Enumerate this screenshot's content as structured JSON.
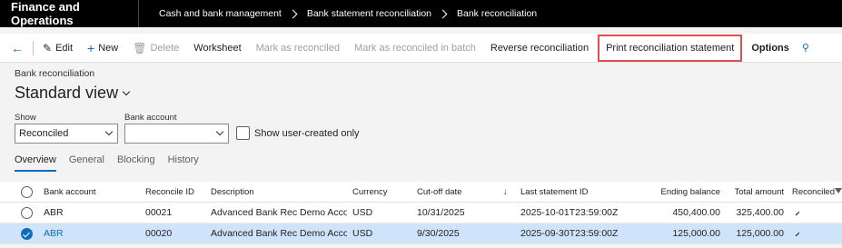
{
  "topbar": {
    "app_title": "Finance and Operations",
    "breadcrumbs": [
      "Cash and bank management",
      "Bank statement reconciliation",
      "Bank reconciliation"
    ]
  },
  "actions": {
    "edit": "Edit",
    "new": "New",
    "delete": "Delete",
    "worksheet": "Worksheet",
    "mark_reconciled": "Mark as reconciled",
    "mark_reconciled_batch": "Mark as reconciled in batch",
    "reverse": "Reverse reconciliation",
    "print_statement": "Print reconciliation statement",
    "options": "Options"
  },
  "page": {
    "breadcrumb": "Bank reconciliation",
    "title": "Standard view"
  },
  "filters": {
    "show_label": "Show",
    "show_value": "Reconciled",
    "bank_account_label": "Bank account",
    "bank_account_value": "",
    "user_created_label": "Show user-created only"
  },
  "tabs": [
    "Overview",
    "General",
    "Blocking",
    "History"
  ],
  "grid": {
    "headers": {
      "bank_account": "Bank account",
      "reconcile_id": "Reconcile ID",
      "description": "Description",
      "currency": "Currency",
      "cutoff": "Cut-off date",
      "last_statement": "Last statement ID",
      "ending_balance": "Ending balance",
      "total_amount": "Total amount",
      "reconciled": "Reconciled"
    },
    "rows": [
      {
        "bank_account": "ABR",
        "reconcile_id": "00021",
        "description": "Advanced Bank Rec Demo Acco…",
        "currency": "USD",
        "cutoff": "10/31/2025",
        "last_statement": "2025-10-01T23:59:00Z",
        "ending_balance": "450,400.00",
        "total_amount": "325,400.00"
      },
      {
        "bank_account": "ABR",
        "reconcile_id": "00020",
        "description": "Advanced Bank Rec Demo Acco…",
        "currency": "USD",
        "cutoff": "9/30/2025",
        "last_statement": "2025-09-30T23:59:00Z",
        "ending_balance": "125,000.00",
        "total_amount": "125,000.00"
      }
    ]
  }
}
